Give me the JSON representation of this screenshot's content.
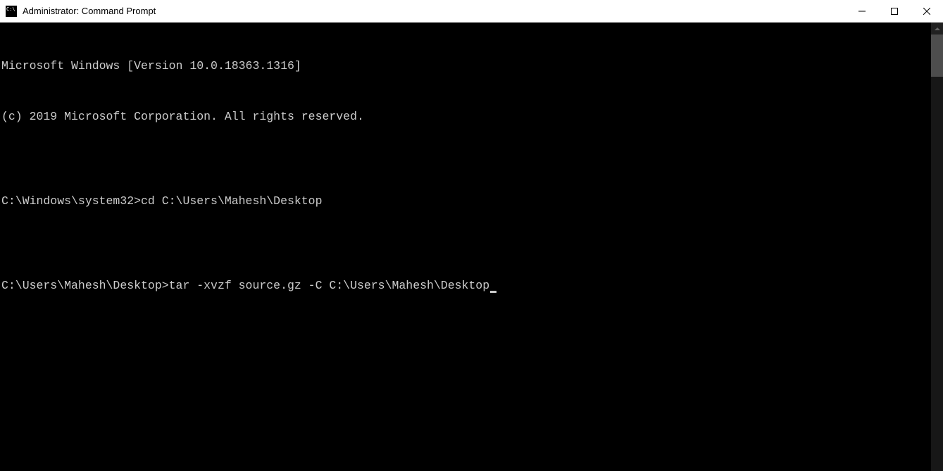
{
  "window": {
    "title": "Administrator: Command Prompt"
  },
  "terminal": {
    "lines": [
      "Microsoft Windows [Version 10.0.18363.1316]",
      "(c) 2019 Microsoft Corporation. All rights reserved.",
      "",
      "C:\\Windows\\system32>cd C:\\Users\\Mahesh\\Desktop",
      "",
      "C:\\Users\\Mahesh\\Desktop>tar -xvzf source.gz -C C:\\Users\\Mahesh\\Desktop"
    ]
  }
}
